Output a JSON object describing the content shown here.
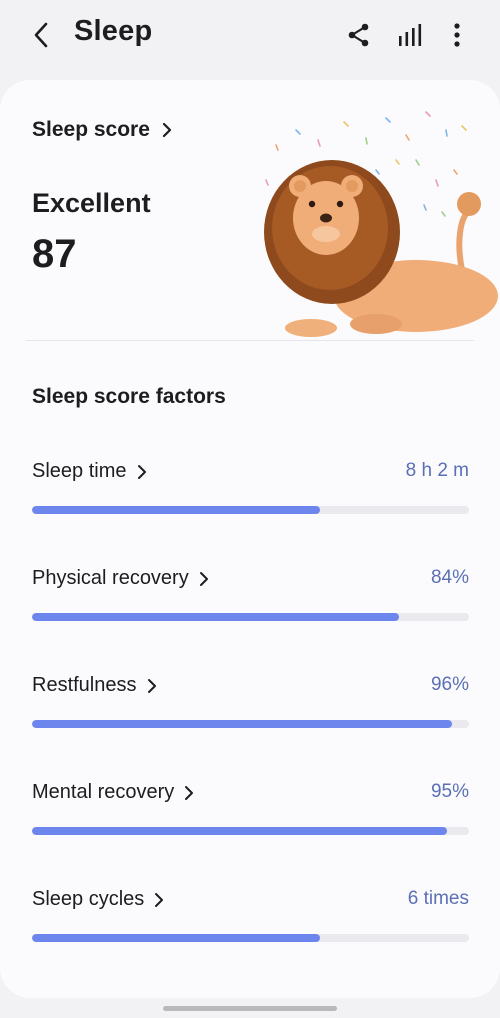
{
  "header": {
    "title": "Sleep",
    "back_icon": "chevron-left-icon",
    "share_icon": "share-icon",
    "chart_icon": "bar-chart-icon",
    "more_icon": "more-vertical-icon"
  },
  "score": {
    "link_label": "Sleep score",
    "rating": "Excellent",
    "value": "87"
  },
  "factors": {
    "title": "Sleep score factors",
    "accent_color": "#6d86ee",
    "value_color": "#5b6fb5",
    "items": [
      {
        "label": "Sleep time",
        "value": "8 h 2 m",
        "fill": 0.66
      },
      {
        "label": "Physical recovery",
        "value": "84%",
        "fill": 0.84
      },
      {
        "label": "Restfulness",
        "value": "96%",
        "fill": 0.96
      },
      {
        "label": "Mental recovery",
        "value": "95%",
        "fill": 0.95
      },
      {
        "label": "Sleep cycles",
        "value": "6 times",
        "fill": 0.66
      }
    ]
  }
}
